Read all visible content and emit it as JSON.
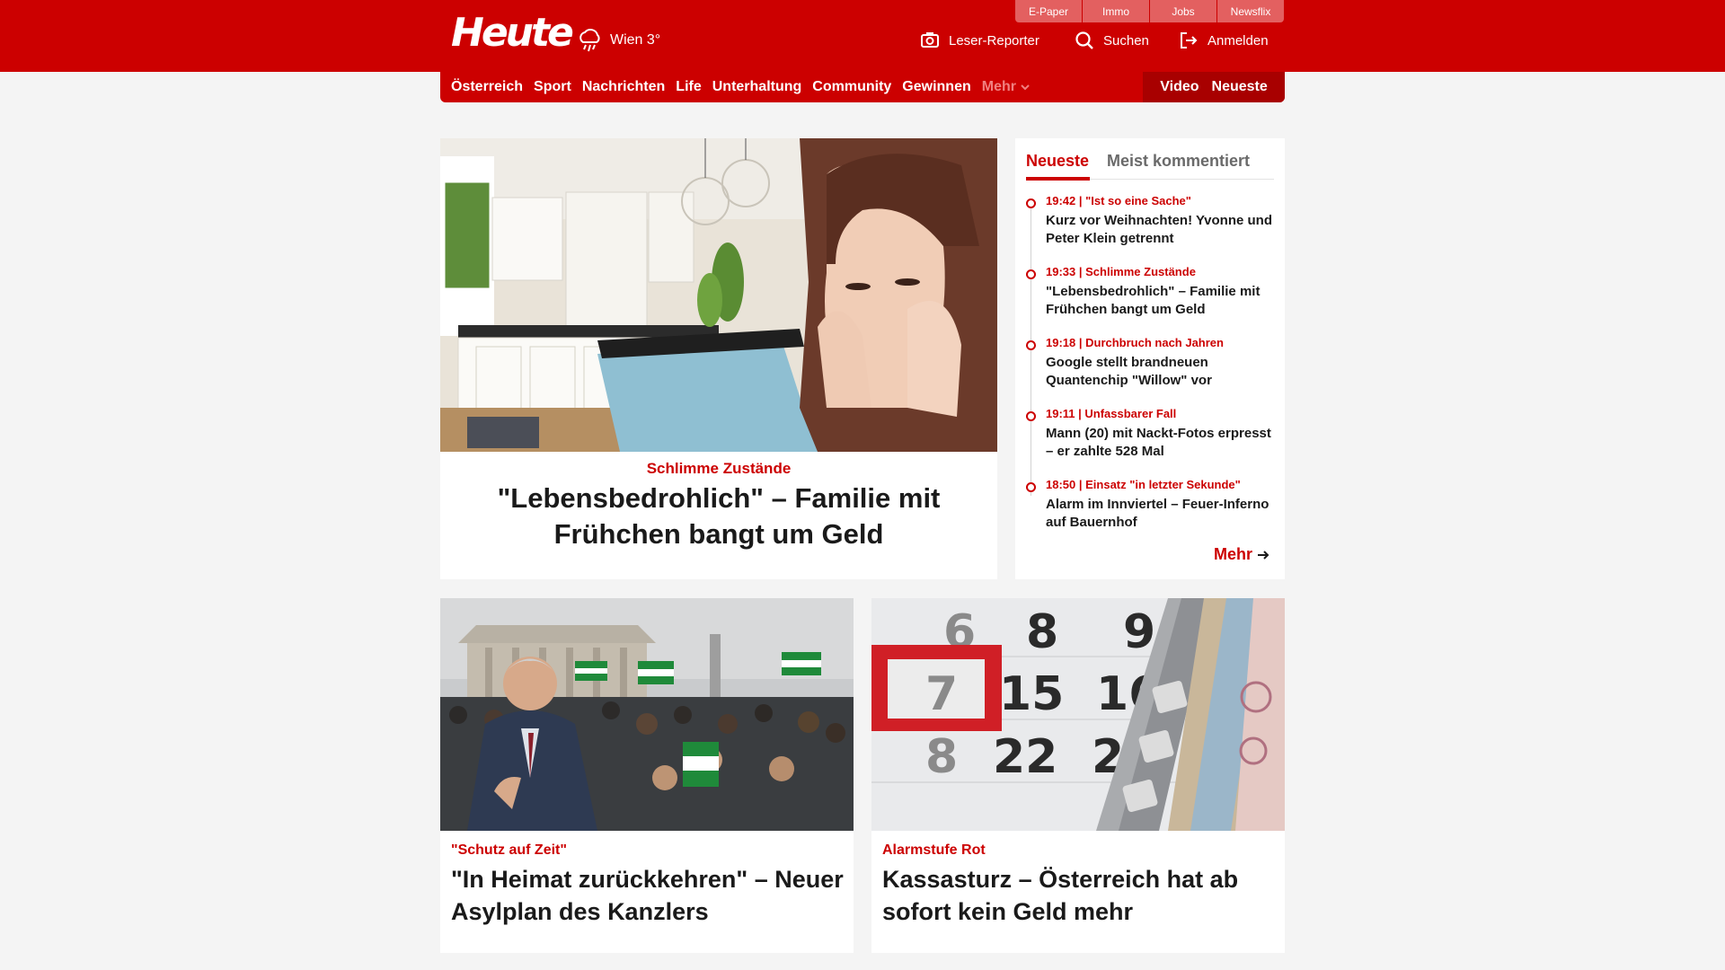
{
  "header": {
    "logo": "Heute",
    "weather": {
      "icon": "rain-cloud-icon",
      "label": "Wien 3°"
    },
    "service_links": [
      "E-Paper",
      "Immo",
      "Jobs",
      "Newsflix"
    ],
    "actions": {
      "reporter": {
        "icon": "camera-icon",
        "label": "Leser-Reporter"
      },
      "search": {
        "icon": "search-icon",
        "label": "Suchen"
      },
      "login": {
        "icon": "login-icon",
        "label": "Anmelden"
      }
    }
  },
  "nav": {
    "items": [
      "Österreich",
      "Sport",
      "Nachrichten",
      "Life",
      "Unterhaltung",
      "Community",
      "Gewinnen"
    ],
    "more": "Mehr",
    "right": [
      "Video",
      "Neueste"
    ]
  },
  "hero": {
    "kicker": "Schlimme Zustände",
    "title": "\"Lebensbedrohlich\" – Familie mit Frühchen bangt um Geld"
  },
  "sidebar": {
    "tabs": [
      "Neueste",
      "Meist kommentiert"
    ],
    "items": [
      {
        "meta": "19:42 | \"Ist so eine Sache\"",
        "title": "Kurz vor Weihnachten! Yvonne und Peter Klein getrennt"
      },
      {
        "meta": "19:33 | Schlimme Zustände",
        "title": "\"Lebensbedrohlich\" – Familie mit Frühchen bangt um Geld"
      },
      {
        "meta": "19:18 | Durchbruch nach Jahren",
        "title": "Google stellt brandneuen Quantenchip \"Willow\" vor"
      },
      {
        "meta": "19:11 | Unfassbarer Fall",
        "title": "Mann (20) mit Nackt-Fotos erpresst – er zahlte 528 Mal"
      },
      {
        "meta": "18:50 | Einsatz \"in letzter Sekunde\"",
        "title": "Alarm im Innviertel – Feuer-Inferno auf Bauernhof"
      }
    ],
    "more": "Mehr"
  },
  "cards": [
    {
      "kicker": "\"Schutz auf Zeit\"",
      "title": "\"In Heimat zurückkehren\" – Neuer Asylplan des Kanzlers"
    },
    {
      "kicker": "Alarmstufe Rot",
      "title": "Kassasturz – Österreich hat ab sofort kein Geld mehr"
    }
  ],
  "calendar": {
    "numbers": [
      "6",
      "8",
      "9",
      "7",
      "15",
      "16",
      "8",
      "22",
      "2"
    ]
  },
  "colors": {
    "brand_red": "#cc0000",
    "dark_red": "#a80000",
    "page_bg": "#f4f4f4"
  }
}
